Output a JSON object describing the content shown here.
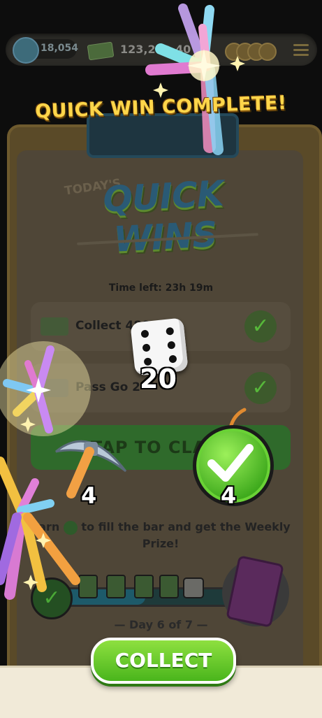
{
  "top_bar": {
    "level": "18,054",
    "cash": "123,20",
    "cash_tail": "40"
  },
  "banner": "QUICK WIN COMPLETE!",
  "panel": {
    "todays_label": "TODAY'S",
    "title": "QUICK WINS",
    "time_left": "Time left: 23h 19m",
    "tasks": [
      {
        "text": "Collect 480",
        "completed": true
      },
      {
        "text": "Pass Go 2",
        "completed": true
      }
    ],
    "claim_label": "TAP TO CLAIM",
    "earn_text_before": "Earn",
    "earn_text_after": "to fill the bar and get the Weekly Prize!",
    "progress_fraction": 0.45,
    "day_label": "— Day 6 of 7 —"
  },
  "rewards": {
    "dice_count": "20",
    "pickaxe_count": "4",
    "checkmark_count": "4"
  },
  "collect_label": "COLLECT",
  "colors": {
    "banner": "#ffd64a",
    "collect_button": "#4ab51c",
    "check_green": "#3faa1d"
  }
}
